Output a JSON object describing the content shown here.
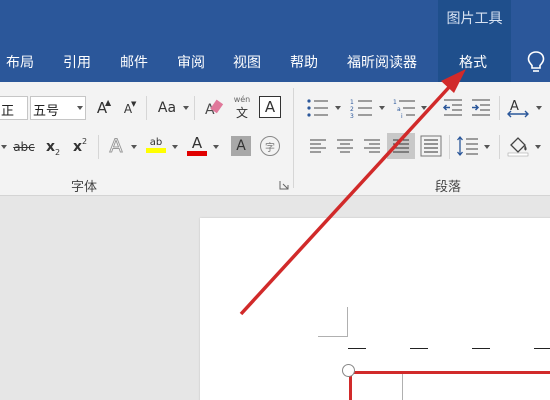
{
  "ribbon": {
    "contextual_group_label": "图片工具",
    "tabs": [
      "布局",
      "引用",
      "邮件",
      "审阅",
      "视图",
      "帮助",
      "福昕阅读器",
      "格式"
    ],
    "active_tab": "格式"
  },
  "font_group": {
    "font_name_value": "正",
    "font_size_value": "五号",
    "label": "字体",
    "buttons": {
      "grow": "A",
      "shrink": "A",
      "change_case": "Aa",
      "phonetic_top": "wén",
      "phonetic_bottom": "文",
      "char_border": "A",
      "strikethrough": "abc",
      "subscript": "x",
      "subscript_mark": "2",
      "superscript": "x",
      "superscript_mark": "2",
      "text_effect": "A",
      "highlight_top": "ab",
      "font_color": "A",
      "char_shading": "A",
      "enclose": "字"
    }
  },
  "paragraph_group": {
    "label": "段落"
  },
  "colors": {
    "ribbon_blue": "#2b579a",
    "highlight_yellow": "#ffff00",
    "font_color_red": "#e00000",
    "annotation_red": "#d12a2a"
  },
  "icons": [
    "lightbulb-icon",
    "eraser-icon",
    "bullets-icon",
    "numbering-icon",
    "multilevel-list-icon",
    "decrease-indent-icon",
    "increase-indent-icon",
    "text-direction-icon",
    "align-left-icon",
    "align-center-icon",
    "align-right-icon",
    "justify-icon",
    "distributed-icon",
    "line-spacing-icon",
    "shading-icon",
    "borders-icon"
  ]
}
